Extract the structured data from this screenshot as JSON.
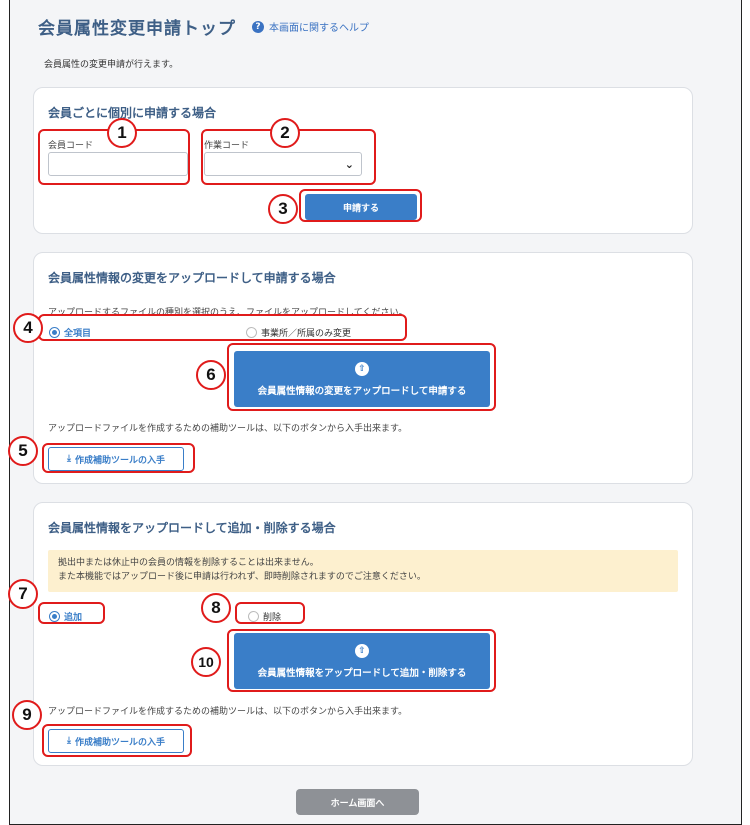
{
  "page": {
    "title": "会員属性変更申請トップ",
    "help_link": "本画面に関するヘルプ",
    "description": "会員属性の変更申請が行えます。"
  },
  "individual": {
    "heading": "会員ごとに個別に申請する場合",
    "member_code_label": "会員コード",
    "member_code_value": "",
    "work_code_label": "作業コード",
    "work_code_selected": "",
    "apply_button": "申請する"
  },
  "upload_change": {
    "heading": "会員属性情報の変更をアップロードして申請する場合",
    "instruction": "アップロードするファイルの種別を選択のうえ、ファイルをアップロードしてください。",
    "radio_all": "全項目",
    "radio_office": "事業所／所属のみ変更",
    "upload_button": "会員属性情報の変更をアップロードして申請する",
    "tool_note": "アップロードファイルを作成するための補助ツールは、以下のボタンから入手出来ます。",
    "tool_button": "作成補助ツールの入手"
  },
  "upload_add_delete": {
    "heading": "会員属性情報をアップロードして追加・削除する場合",
    "warning_line1": "拠出中または休止中の会員の情報を削除することは出来ません。",
    "warning_line2": "また本機能ではアップロード後に申請は行われず、即時削除されますのでご注意ください。",
    "radio_add": "追加",
    "radio_delete": "削除",
    "upload_button": "会員属性情報をアップロードして追加・削除する",
    "tool_note": "アップロードファイルを作成するための補助ツールは、以下のボタンから入手出来ます。",
    "tool_button": "作成補助ツールの入手"
  },
  "footer": {
    "home_button": "ホーム画面へ"
  },
  "callouts": {
    "n1": "1",
    "n2": "2",
    "n3": "3",
    "n4": "4",
    "n5": "5",
    "n6": "6",
    "n7": "7",
    "n8": "8",
    "n9": "9",
    "n10": "10"
  },
  "colors": {
    "accent": "#3a7ec8",
    "heading": "#3e5f86",
    "annotation_red": "#e01b1b",
    "warning_bg": "#fdf0cf"
  },
  "icons": {
    "help": "question-circle-icon",
    "upload": "upload-icon",
    "download": "download-icon",
    "select": "chevron-down-icon"
  }
}
